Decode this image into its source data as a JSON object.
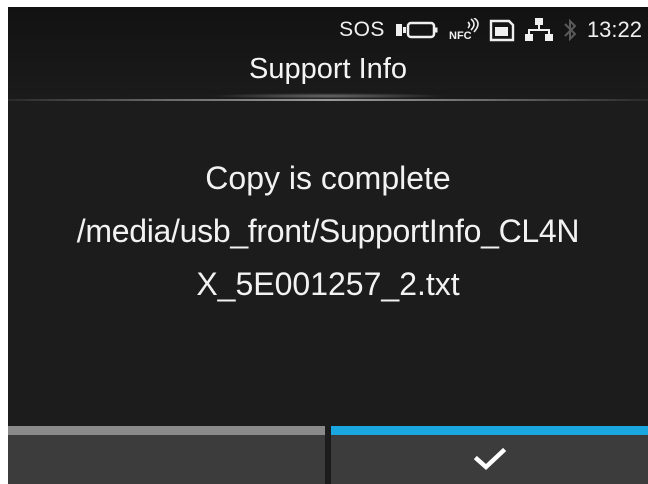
{
  "status_bar": {
    "sos_label": "SOS",
    "icons": [
      "battery-icon",
      "nfc-icon",
      "sd-card-icon",
      "network-icon",
      "bluetooth-icon"
    ],
    "time": "13:22"
  },
  "header": {
    "title": "Support Info"
  },
  "message": {
    "line1": "Copy is complete",
    "line2": "/media/usb_front/SupportInfo_CL4N",
    "line3": "X_5E001257_2.txt"
  },
  "softkeys": {
    "left": {
      "label": "",
      "indicator_color": "#8a8a8a"
    },
    "right": {
      "icon": "checkmark-icon",
      "indicator_color": "#1aa7e0"
    }
  },
  "colors": {
    "background": "#1c1c1c",
    "softkey_background": "#3c3c3c",
    "accent": "#1aa7e0"
  }
}
